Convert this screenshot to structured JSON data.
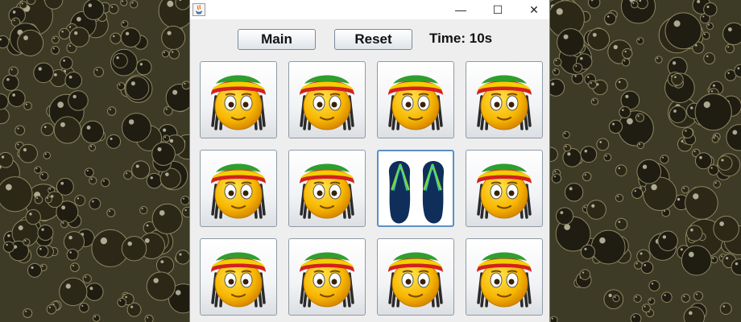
{
  "window": {
    "title": "",
    "controls": {
      "minimize": "—",
      "maximize": "☐",
      "close": "✕"
    }
  },
  "toolbar": {
    "main_label": "Main",
    "reset_label": "Reset",
    "timer_text": "Time: 10s"
  },
  "board": {
    "rows": 3,
    "cols": 4,
    "cards": [
      {
        "face": "rasta-smiley-icon",
        "revealed": false
      },
      {
        "face": "rasta-smiley-icon",
        "revealed": false
      },
      {
        "face": "rasta-smiley-icon",
        "revealed": false
      },
      {
        "face": "rasta-smiley-icon",
        "revealed": false
      },
      {
        "face": "rasta-smiley-icon",
        "revealed": false
      },
      {
        "face": "rasta-smiley-icon",
        "revealed": false
      },
      {
        "face": "flip-flops-icon",
        "revealed": true
      },
      {
        "face": "rasta-smiley-icon",
        "revealed": false
      },
      {
        "face": "rasta-smiley-icon",
        "revealed": false
      },
      {
        "face": "rasta-smiley-icon",
        "revealed": false
      },
      {
        "face": "rasta-smiley-icon",
        "revealed": false
      },
      {
        "face": "rasta-smiley-icon",
        "revealed": false
      }
    ]
  },
  "colors": {
    "background": "#3d3a26",
    "card_border": "#8e9aa6",
    "selected_border": "#5c8fc7",
    "flipflop_body": "#0f2f5a",
    "flipflop_strap": "#7cd63a"
  }
}
